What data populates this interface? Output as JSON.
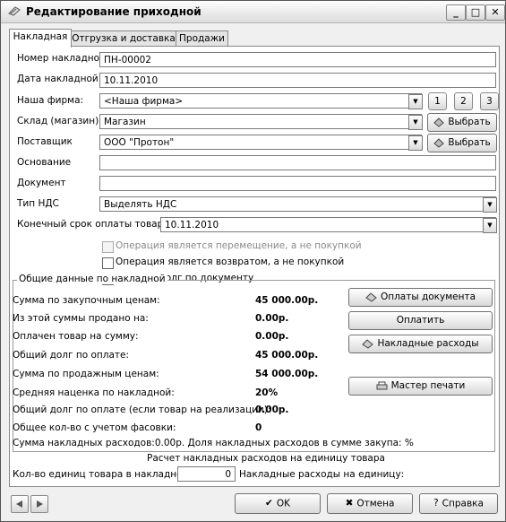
{
  "window": {
    "title": "Редактирование приходной",
    "min": "_",
    "max": "□",
    "close": "✕"
  },
  "tabs": [
    "Накладная",
    "Отгрузка и доставка",
    "Продажи"
  ],
  "form": {
    "number_label": "Номер накладной",
    "number_value": "ПН-00002",
    "date_label": "Дата накладной",
    "date_value": "10.11.2010",
    "firm_label": "Наша фирма:",
    "firm_value": "<Наша фирма>",
    "firm_buttons": [
      "1",
      "2",
      "3"
    ],
    "warehouse_label": "Склад (магазин)",
    "warehouse_value": "Магазин",
    "supplier_label": "Поставщик",
    "supplier_value": "ООО \"Протон\"",
    "select_label": "Выбрать",
    "basis_label": "Основание",
    "basis_value": "",
    "document_label": "Документ",
    "document_value": "",
    "vat_label": "Тип НДС",
    "vat_value": "Выделять НДС",
    "due_label": "Конечный срок оплаты товара",
    "due_value": "10.11.2010"
  },
  "checkboxes": [
    {
      "label": "Операция является перемещение, а не покупкой",
      "checked": false,
      "disabled": true
    },
    {
      "label": "Операция является возвратом, а не покупкой",
      "checked": false,
      "disabled": false
    },
    {
      "label": "Считать долг по документу",
      "checked": true,
      "disabled": false
    }
  ],
  "summary": {
    "group_title": "Общие данные по накладной",
    "rows": [
      {
        "label": "Сумма по закупочным ценам:",
        "value": "45 000.00р."
      },
      {
        "label": "Из этой суммы продано на:",
        "value": "0.00р."
      },
      {
        "label": "Оплачен товар на сумму:",
        "value": "0.00р."
      },
      {
        "label": "Общий долг по оплате:",
        "value": "45 000.00р."
      },
      {
        "label": "Сумма по продажным ценам:",
        "value": "54 000.00р."
      },
      {
        "label": "Средняя наценка по накладной:",
        "value": "20%"
      },
      {
        "label": "Общий долг по оплате (если товар на реализации):",
        "value": "0.00р."
      },
      {
        "label": "Общее кол-во с учетом фасовки:",
        "value": "0"
      }
    ],
    "buttons": {
      "doc_payments": "Оплаты документа",
      "pay": "Оплатить",
      "overhead": "Накладные расходы",
      "print_master": "Мастер печати"
    },
    "overhead_line": "Сумма накладных расходов:0.00р.  Доля накладных расходов в сумме закупа: %",
    "unit_title": "Расчет накладных расходов на единицу товара",
    "unit_qty_label": "Кол-во единиц товара в накладной:",
    "unit_qty_value": "0",
    "unit_cost_label": "Накладные расходы на единицу:"
  },
  "footer": {
    "ok": "OK",
    "cancel": "Отмена",
    "help": "Справка"
  }
}
